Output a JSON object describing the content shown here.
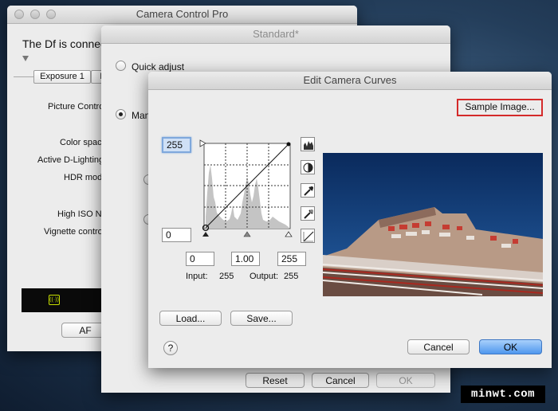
{
  "camera_control": {
    "title": "Camera Control Pro",
    "status": "The Df is connec",
    "tabs": [
      "Exposure 1",
      "E"
    ],
    "labels": [
      "Picture Contro",
      "Color spac",
      "Active D-Lighting",
      "HDR mode",
      "High ISO NI",
      "Vignette contro"
    ],
    "af_button": "AF"
  },
  "standard": {
    "title": "Standard*",
    "quick_adjust": "Quick adjust",
    "manual": "Manu",
    "reset": "Reset",
    "cancel": "Cancel",
    "ok": "OK"
  },
  "curves": {
    "title": "Edit Camera Curves",
    "sample_image": "Sample Image...",
    "output_max": "255",
    "output_min": "0",
    "black_point": "0",
    "gamma": "1.00",
    "white_point": "255",
    "input_label": "Input:",
    "input_value": "255",
    "output_label": "Output:",
    "output_value": "255",
    "load": "Load...",
    "save": "Save...",
    "help": "?",
    "cancel": "Cancel",
    "ok": "OK",
    "tool_icons": [
      "histogram-icon",
      "contrast-icon",
      "black-eyedropper-icon",
      "gray-eyedropper-icon",
      "linear-curve-icon"
    ]
  },
  "watermark": "minwt.com",
  "colors": {
    "highlight_border": "#d42a2a",
    "ok_blue": "#4f97ee"
  }
}
